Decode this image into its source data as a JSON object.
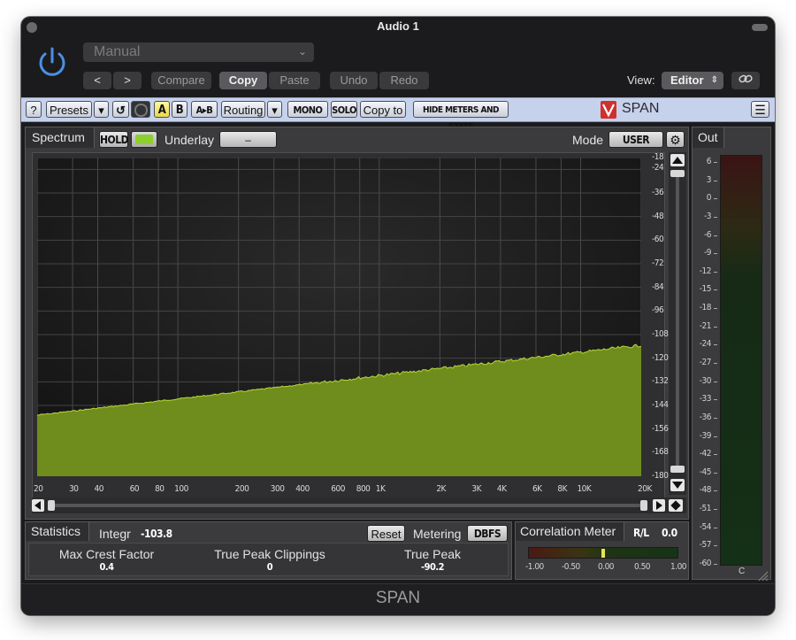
{
  "window": {
    "title": "Audio 1"
  },
  "host": {
    "preset": "Manual",
    "nav_prev": "<",
    "nav_next": ">",
    "compare": "Compare",
    "copy": "Copy",
    "paste": "Paste",
    "undo": "Undo",
    "redo": "Redo",
    "view_label": "View:",
    "view_value": "Editor",
    "view_arrows": "⌃⌄",
    "link_icon": "link-icon"
  },
  "toolbar": {
    "help": "?",
    "presets": "Presets",
    "dropdown": "▾",
    "reset_icon": "↺",
    "a": "A",
    "b": "B",
    "a_to_b": "A▸B",
    "routing": "Routing",
    "mono": "MONO",
    "solo": "SOLO",
    "copy_to": "Copy to",
    "hide_meters": "HIDE METERS AND STATS",
    "brand": "SPAN",
    "menu_icon": "☰"
  },
  "spectrum": {
    "tab": "Spectrum",
    "hold": "HOLD",
    "underlay_label": "Underlay",
    "underlay_value": "–",
    "mode_label": "Mode",
    "mode_value": "USER",
    "y_ticks": [
      "-18",
      "-24",
      "-36",
      "-48",
      "-60",
      "-72",
      "-84",
      "-96",
      "-108",
      "-120",
      "-132",
      "-144",
      "-156",
      "-168",
      "-180"
    ],
    "x_ticks": [
      "20",
      "30",
      "40",
      "60",
      "80",
      "100",
      "200",
      "300",
      "400",
      "600",
      "800",
      "1K",
      "2K",
      "3K",
      "4K",
      "6K",
      "8K",
      "10K",
      "20K"
    ],
    "fill_color": "#6f8d1c",
    "line_color": "#b8d83a"
  },
  "out_meter": {
    "tab": "Out",
    "ticks": [
      "6",
      "3",
      "0",
      "-3",
      "-6",
      "-9",
      "-12",
      "-15",
      "-18",
      "-21",
      "-24",
      "-27",
      "-30",
      "-33",
      "-36",
      "-39",
      "-42",
      "-45",
      "-48",
      "-51",
      "-54",
      "-57",
      "-60"
    ],
    "channel": "C"
  },
  "statistics": {
    "tab": "Statistics",
    "integr_label": "Integr",
    "integr_value": "-103.8",
    "reset": "Reset",
    "metering_label": "Metering",
    "metering_value": "DBFS",
    "max_crest_label": "Max Crest Factor",
    "max_crest_value": "0.4",
    "clippings_label": "True Peak Clippings",
    "clippings_value": "0",
    "true_peak_label": "True Peak",
    "true_peak_value": "-90.2"
  },
  "correlation": {
    "tab": "Correlation Meter",
    "rl_label": "R/L",
    "rl_value": "0.0",
    "scale": [
      "-1.00",
      "-0.50",
      "0.00",
      "0.50",
      "1.00"
    ],
    "needle_value": 0.0
  },
  "footer": {
    "name": "SPAN"
  },
  "colors": {
    "toolbar_bg": "#c6d1ec",
    "accent_green": "#8ccf2f",
    "yellow": "#f3e56a"
  }
}
